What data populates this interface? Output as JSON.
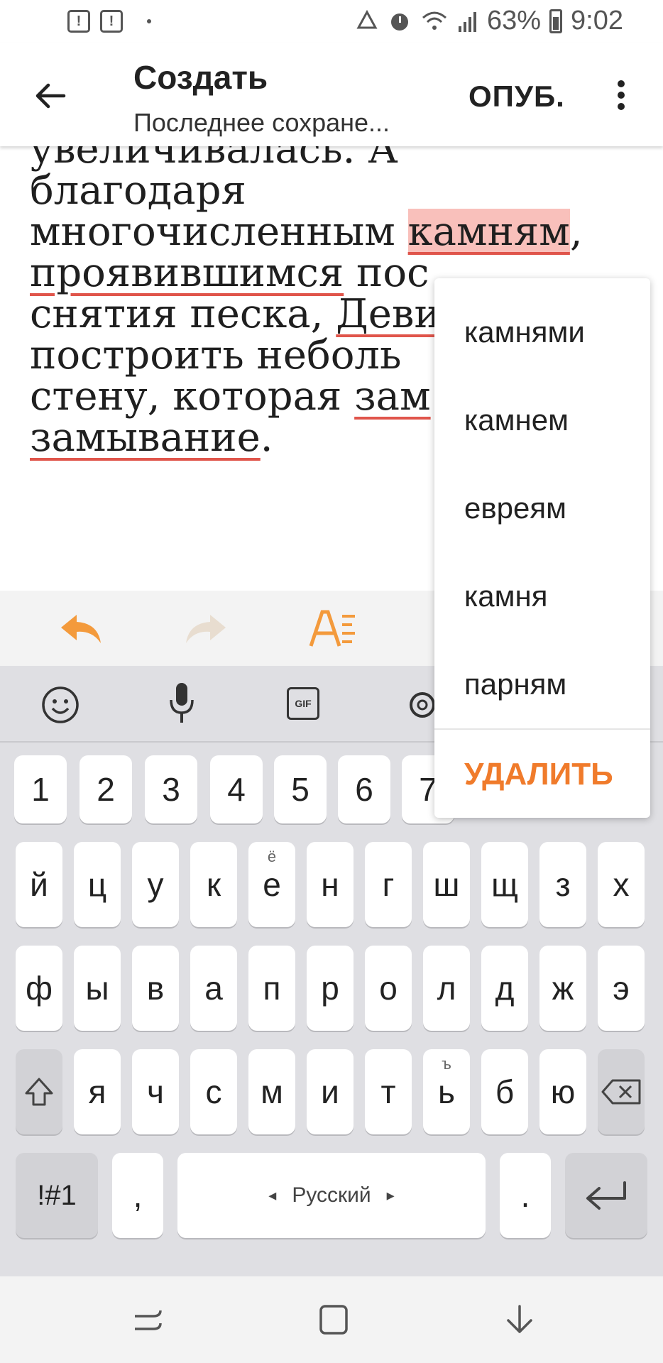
{
  "status_bar": {
    "battery": "63%",
    "time": "9:02"
  },
  "app_bar": {
    "title": "Создать",
    "subtitle": "Последнее сохране...",
    "publish_label": "ОПУБ."
  },
  "editor": {
    "line1": "увеличивалась. А",
    "line2": "благодаря",
    "line3_prefix": "многочисленным ",
    "line3_word": "камням",
    "line3_suffix": ",",
    "line4_word": "проявившимся",
    "line4_suffix": " пос",
    "line5_prefix": "снятия песка, ",
    "line5_word": "Деви",
    "line6": "построить неболь",
    "line7_prefix": "стену, которая ",
    "line7_word": "зам",
    "line8_word": "замывание",
    "line8_suffix": "."
  },
  "suggestions": {
    "items": [
      "камнями",
      "камнем",
      "евреям",
      "камня",
      "парням"
    ],
    "delete_label": "УДАЛИТЬ"
  },
  "keyboard": {
    "row_numbers": [
      "1",
      "2",
      "3",
      "4",
      "5",
      "6",
      "7"
    ],
    "row1": [
      "й",
      "ц",
      "у",
      "к",
      "е",
      "н",
      "г",
      "ш",
      "щ",
      "з",
      "х"
    ],
    "row1_hint_e": "ё",
    "row2": [
      "ф",
      "ы",
      "в",
      "а",
      "п",
      "р",
      "о",
      "л",
      "д",
      "ж",
      "э"
    ],
    "row3": [
      "я",
      "ч",
      "с",
      "м",
      "и",
      "т",
      "ь",
      "б",
      "ю"
    ],
    "row3_hint_soft": "ъ",
    "symbols_label": "!#1",
    "comma_label": ",",
    "space_label": "Русский",
    "period_label": ".",
    "gif_label": "GIF"
  },
  "colors": {
    "accent": "#f07b2b",
    "highlight": "#f9c0bb",
    "underline": "#e0554b"
  }
}
